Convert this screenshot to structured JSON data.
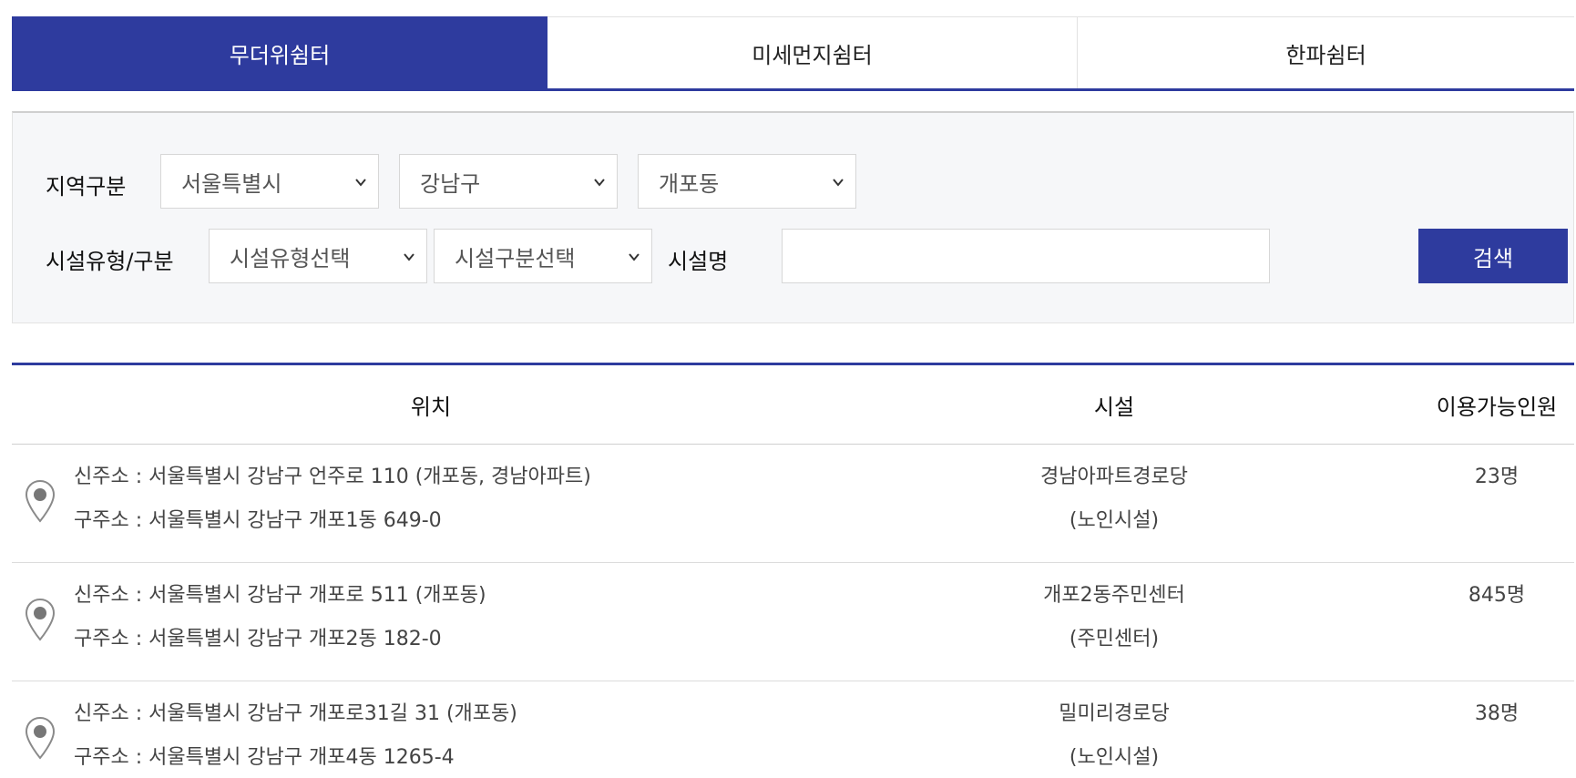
{
  "tabs": [
    {
      "label": "무더위쉼터",
      "active": true
    },
    {
      "label": "미세먼지쉼터",
      "active": false
    },
    {
      "label": "한파쉼터",
      "active": false
    }
  ],
  "search": {
    "region_label": "지역구분",
    "region_city": "서울특별시",
    "region_district": "강남구",
    "region_dong": "개포동",
    "facility_type_label": "시설유형/구분",
    "facility_type": "시설유형선택",
    "facility_category": "시설구분선택",
    "facility_name_label": "시설명",
    "facility_name_value": "",
    "search_button": "검색"
  },
  "table": {
    "headers": {
      "location": "위치",
      "facility": "시설",
      "capacity": "이용가능인원"
    },
    "rows": [
      {
        "new_address": "신주소 : 서울특별시 강남구 언주로 110 (개포동, 경남아파트)",
        "old_address": "구주소 : 서울특별시 강남구 개포1동 649-0",
        "facility_name": "경남아파트경로당",
        "facility_type": "(노인시설)",
        "capacity": "23명"
      },
      {
        "new_address": "신주소 : 서울특별시 강남구 개포로 511 (개포동)",
        "old_address": "구주소 : 서울특별시 강남구 개포2동 182-0",
        "facility_name": "개포2동주민센터",
        "facility_type": "(주민센터)",
        "capacity": "845명"
      },
      {
        "new_address": "신주소 : 서울특별시 강남구 개포로31길 31 (개포동)",
        "old_address": "구주소 : 서울특별시 강남구 개포4동 1265-4",
        "facility_name": "밀미리경로당",
        "facility_type": "(노인시설)",
        "capacity": "38명"
      }
    ]
  },
  "colors": {
    "accent": "#2e3b9e",
    "panel_bg": "#f6f7f9",
    "pin": "#777777"
  },
  "icons": {
    "pin": "location-pin-icon",
    "dropdown": "chevron-down-icon"
  }
}
